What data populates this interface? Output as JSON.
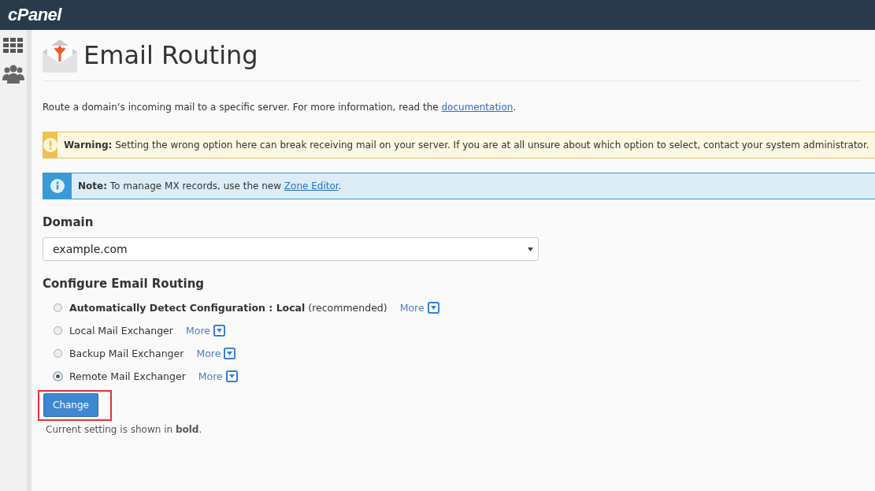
{
  "header": {
    "logo": "cPanel"
  },
  "page": {
    "title": "Email Routing",
    "intro": "Route a domain’s incoming mail to a specific server. For more information, read the ",
    "intro_link": "documentation",
    "intro_end": "."
  },
  "alerts": [
    {
      "kind": "warning",
      "text": "**Warning:** Setting the wrong option here can break receiving mail on your server. If you are at all unsure about which option to select, contact your system administrator."
    },
    {
      "kind": "info",
      "text": "**Note:** To manage MX records, use the new ",
      "link": "Zone Editor",
      "end": "."
    }
  ],
  "domain": {
    "label": "Domain",
    "value": "example.com"
  },
  "routing": {
    "heading": "Configure Email Routing",
    "options": [
      {
        "label": "**Automatically Detect Configuration : Local** (recommended)",
        "more": "More",
        "selected": false
      },
      {
        "label": "Local Mail Exchanger",
        "more": "More",
        "selected": false
      },
      {
        "label": "Backup Mail Exchanger",
        "more": "More",
        "selected": false
      },
      {
        "label": "Remote Mail Exchanger",
        "more": "More",
        "selected": true
      }
    ],
    "button": "Change",
    "note": "Current setting is shown in **bold**."
  }
}
